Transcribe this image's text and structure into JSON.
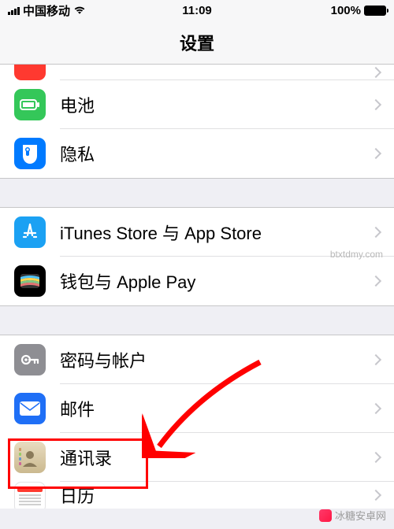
{
  "status": {
    "carrier": "中国移动",
    "time": "11:09",
    "battery_pct": "100%"
  },
  "header": {
    "title": "设置"
  },
  "groups": [
    {
      "rows": [
        {
          "key": "prev-partial",
          "label": "",
          "icon_bg": "#ff3930"
        },
        {
          "key": "battery",
          "label": "电池",
          "icon_bg": "#34c759"
        },
        {
          "key": "privacy",
          "label": "隐私",
          "icon_bg": "#007aff"
        }
      ]
    },
    {
      "rows": [
        {
          "key": "itunes",
          "label": "iTunes Store 与 App Store",
          "icon_bg": "#1ba1f3"
        },
        {
          "key": "wallet",
          "label": "钱包与 Apple Pay",
          "icon_bg": "#000000"
        }
      ]
    },
    {
      "rows": [
        {
          "key": "passwords",
          "label": "密码与帐户",
          "icon_bg": "#8e8e93"
        },
        {
          "key": "mail",
          "label": "邮件",
          "icon_bg": "#1f6ff6"
        },
        {
          "key": "contacts",
          "label": "通讯录",
          "icon_bg": "#d7c9a8"
        },
        {
          "key": "calendar",
          "label": "日历",
          "icon_bg": "#ffffff"
        }
      ]
    }
  ],
  "annotation": {
    "highlight_target": "contacts"
  },
  "watermarks": {
    "text1": "btxtdmy.com",
    "text2": "冰糖安卓网"
  }
}
